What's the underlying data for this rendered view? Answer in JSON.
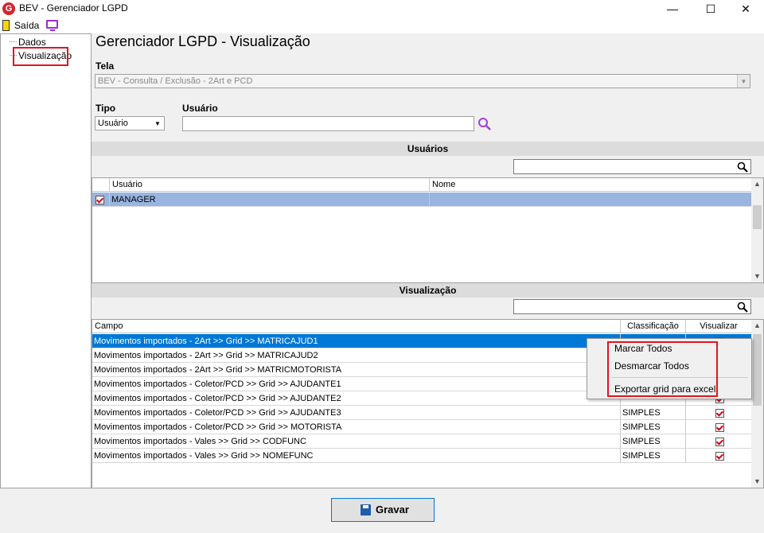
{
  "window": {
    "title": "BEV - Gerenciador LGPD",
    "logo_letter": "G",
    "minimize": "—",
    "maximize": "☐",
    "close": "✕"
  },
  "menu": {
    "exit_label": "Saída"
  },
  "tree": {
    "items": [
      "Dados",
      "Visualização"
    ]
  },
  "page": {
    "title": "Gerenciador LGPD - Visualização"
  },
  "form": {
    "tela_label": "Tela",
    "tela_value": "BEV - Consulta / Exclusão - 2Art e PCD",
    "tipo_label": "Tipo",
    "tipo_value": "Usuário",
    "usuario_label": "Usuário",
    "usuario_value": ""
  },
  "users_section": {
    "title": "Usuários",
    "columns": [
      "Usuário",
      "Nome"
    ],
    "rows": [
      {
        "usuario": "MANAGER",
        "nome": "",
        "checked": true
      }
    ]
  },
  "view_section": {
    "title": "Visualização",
    "columns": [
      "Campo",
      "Classificação",
      "Visualizar"
    ],
    "rows": [
      {
        "campo": "Movimentos importados - 2Art >> Grid >> MATRICAJUD1",
        "class": "",
        "checked": true
      },
      {
        "campo": "Movimentos importados - 2Art >> Grid >> MATRICAJUD2",
        "class": "",
        "checked": true
      },
      {
        "campo": "Movimentos importados - 2Art >> Grid >> MATRICMOTORISTA",
        "class": "",
        "checked": true
      },
      {
        "campo": "Movimentos importados - Coletor/PCD >> Grid >> AJUDANTE1",
        "class": "",
        "checked": true
      },
      {
        "campo": "Movimentos importados - Coletor/PCD >> Grid >> AJUDANTE2",
        "class": "",
        "checked": true
      },
      {
        "campo": "Movimentos importados - Coletor/PCD >> Grid >> AJUDANTE3",
        "class": "SIMPLES",
        "checked": true
      },
      {
        "campo": "Movimentos importados - Coletor/PCD >> Grid >> MOTORISTA",
        "class": "SIMPLES",
        "checked": true
      },
      {
        "campo": "Movimentos importados - Vales >> Grid >> CODFUNC",
        "class": "SIMPLES",
        "checked": true
      },
      {
        "campo": "Movimentos importados - Vales >> Grid >> NOMEFUNC",
        "class": "SIMPLES",
        "checked": true
      }
    ]
  },
  "context_menu": {
    "items": [
      "Marcar Todos",
      "Desmarcar Todos",
      "Exportar grid para excel"
    ]
  },
  "footer": {
    "save_label": "Gravar"
  },
  "colors": {
    "selection": "#0078d7",
    "row_highlight": "#99b4e0",
    "annotation": "#e0141e"
  }
}
